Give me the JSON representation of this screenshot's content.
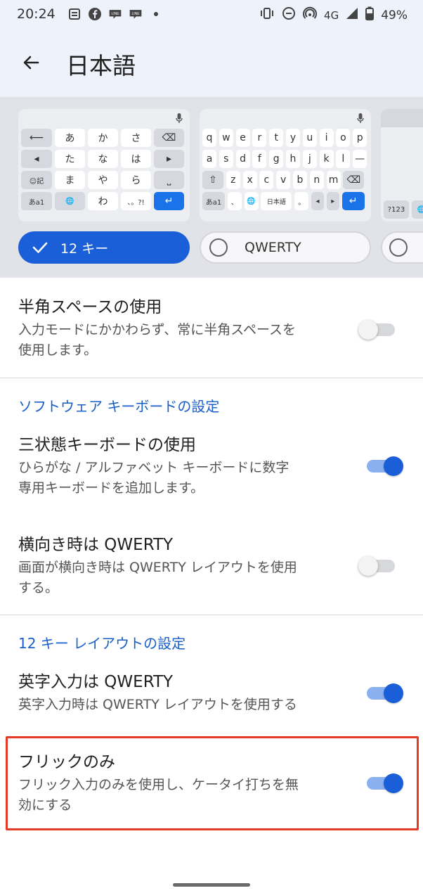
{
  "status_bar": {
    "time": "20:24",
    "network": "4G",
    "battery": "49%",
    "line_badge": "LINE"
  },
  "app_bar": {
    "title": "日本語"
  },
  "keyboard_layouts": {
    "twelve_key": {
      "rows": [
        [
          "⟵",
          "あ",
          "か",
          "さ",
          "⌫"
        ],
        [
          "◂",
          "た",
          "な",
          "は",
          "▸"
        ],
        [
          "☺記",
          "ま",
          "や",
          "ら",
          "⎵"
        ],
        [
          "あa1",
          "🌐",
          "わ",
          "、。?!",
          "↵"
        ]
      ]
    },
    "qwerty": {
      "rows": [
        [
          "q",
          "w",
          "e",
          "r",
          "t",
          "y",
          "u",
          "i",
          "o",
          "p"
        ],
        [
          "a",
          "s",
          "d",
          "f",
          "g",
          "h",
          "j",
          "k",
          "l",
          "—"
        ],
        [
          "⇧",
          "z",
          "x",
          "c",
          "v",
          "b",
          "n",
          "m",
          "⌫"
        ],
        [
          "あa1",
          "、",
          "🌐",
          "日本語",
          "。",
          "◂",
          "▸",
          "↵"
        ]
      ]
    },
    "third_partial": {
      "bottom_keys": [
        "?123",
        "🌐"
      ]
    },
    "options": [
      {
        "label": "12 キー",
        "selected": true
      },
      {
        "label": "QWERTY",
        "selected": false
      }
    ]
  },
  "settings": {
    "half_space": {
      "title": "半角スペースの使用",
      "desc_lines": [
        "入力モードにかかわらず、常に半角スペースを",
        "使用します。"
      ],
      "enabled": false
    },
    "section_software": "ソフトウェア キーボードの設定",
    "tristate": {
      "title": "三状態キーボードの使用",
      "desc_lines": [
        "ひらがな / アルファベット キーボードに数字",
        "専用キーボードを追加します。"
      ],
      "enabled": true
    },
    "landscape_qwerty": {
      "title": "横向き時は QWERTY",
      "desc_lines": [
        "画面が横向き時は QWERTY レイアウトを使用",
        "する。"
      ],
      "enabled": false
    },
    "section_12key": "12 キー レイアウトの設定",
    "alpha_qwerty": {
      "title": "英字入力は QWERTY",
      "desc_lines": [
        "英字入力時は QWERTY レイアウトを使用する"
      ],
      "enabled": true
    },
    "flick_only": {
      "title": "フリックのみ",
      "desc_lines": [
        "フリック入力のみを使用し、ケータイ打ちを無",
        "効にする"
      ],
      "enabled": true
    }
  },
  "colors": {
    "accent": "#1a5fd8",
    "section_text": "#1a5fc9",
    "highlight_border": "#e53a26"
  }
}
